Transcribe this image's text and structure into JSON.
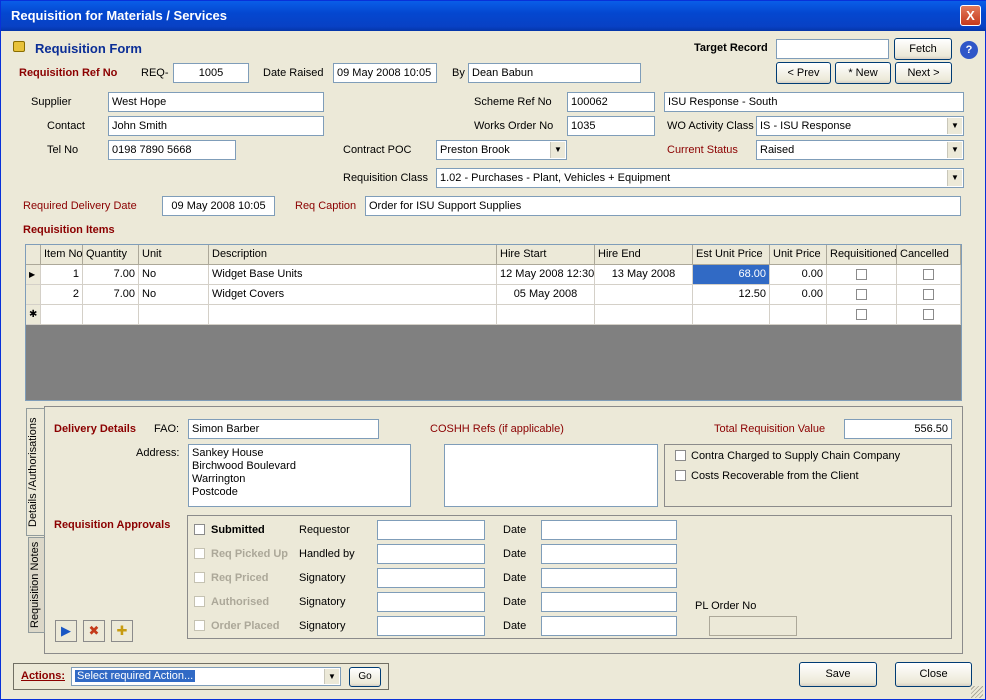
{
  "window": {
    "title": "Requisition for Materials / Services",
    "close": "X"
  },
  "header": {
    "form_title": "Requisition Form",
    "target_record_label": "Target Record",
    "target_record_value": "",
    "fetch": "Fetch",
    "help": "?",
    "prev": "< Prev",
    "new": "* New",
    "next": "Next >"
  },
  "ref": {
    "label": "Requisition Ref No",
    "prefix": "REQ-",
    "number": "1005",
    "date_raised_label": "Date Raised",
    "date_raised": "09 May 2008 10:05",
    "by_label": "By",
    "by": "Dean Babun"
  },
  "supplier": {
    "supplier_label": "Supplier",
    "supplier": "West Hope",
    "contact_label": "Contact",
    "contact": "John Smith",
    "tel_label": "Tel No",
    "tel": "0198 7890 5668"
  },
  "scheme": {
    "scheme_label": "Scheme Ref No",
    "scheme_ref": "100062",
    "scheme_name": "ISU Response - South",
    "works_label": "Works Order No",
    "works_order": "1035",
    "wo_activity_label": "WO Activity Class",
    "wo_activity": "IS - ISU Response",
    "contract_poc_label": "Contract POC",
    "contract_poc": "Preston Brook",
    "status_label": "Current Status",
    "status": "Raised",
    "req_class_label": "Requisition Class",
    "req_class": "1.02 - Purchases - Plant, Vehicles + Equipment"
  },
  "delivery_date": {
    "label": "Required Delivery Date",
    "value": "09 May 2008 10:05",
    "caption_label": "Req Caption",
    "caption": "Order for ISU Support Supplies"
  },
  "items": {
    "label": "Requisition Items",
    "columns": [
      "Item No",
      "Quantity",
      "Unit",
      "Description",
      "Hire Start",
      "Hire End",
      "Est Unit Price",
      "Unit Price",
      "Requisitioned",
      "Cancelled"
    ],
    "rows": [
      {
        "marker": "▶",
        "item": "1",
        "qty": "7.00",
        "unit": "No",
        "desc": "Widget Base Units",
        "start": "12 May 2008 12:30",
        "end": "13 May 2008",
        "est": "68.00",
        "price": "0.00"
      },
      {
        "marker": "",
        "item": "2",
        "qty": "7.00",
        "unit": "No",
        "desc": "Widget Covers",
        "start": "05 May 2008",
        "end": "",
        "est": "12.50",
        "price": "0.00"
      }
    ],
    "new_marker": "✱"
  },
  "tabs": {
    "details": "Details /Authorisations",
    "notes": "Requisition Notes"
  },
  "delivery": {
    "label": "Delivery Details",
    "fao_label": "FAO:",
    "fao": "Simon Barber",
    "address_label": "Address:",
    "address": [
      "Sankey House",
      "Birchwood Boulevard",
      "Warrington",
      "Postcode"
    ],
    "coshh_label": "COSHH Refs (if applicable)",
    "total_label": "Total Requisition Value",
    "total": "556.50",
    "contra": "Contra Charged to Supply Chain Company",
    "recoverable": "Costs Recoverable from the Client"
  },
  "approvals": {
    "label": "Requisition Approvals",
    "date_label": "Date",
    "rows": [
      {
        "step": "Submitted",
        "role": "Requestor",
        "enabled": true
      },
      {
        "step": "Req Picked Up",
        "role": "Handled by",
        "enabled": false
      },
      {
        "step": "Req Priced",
        "role": "Signatory",
        "enabled": false
      },
      {
        "step": "Authorised",
        "role": "Signatory",
        "enabled": false
      },
      {
        "step": "Order Placed",
        "role": "Signatory",
        "enabled": false
      }
    ],
    "pl_order_label": "PL Order No"
  },
  "footer": {
    "actions_label": "Actions:",
    "action_value": "Select required Action...",
    "go": "Go",
    "save": "Save",
    "close": "Close"
  },
  "icons": [
    "open-folder-icon",
    "delete-folder-icon",
    "new-folder-icon"
  ]
}
